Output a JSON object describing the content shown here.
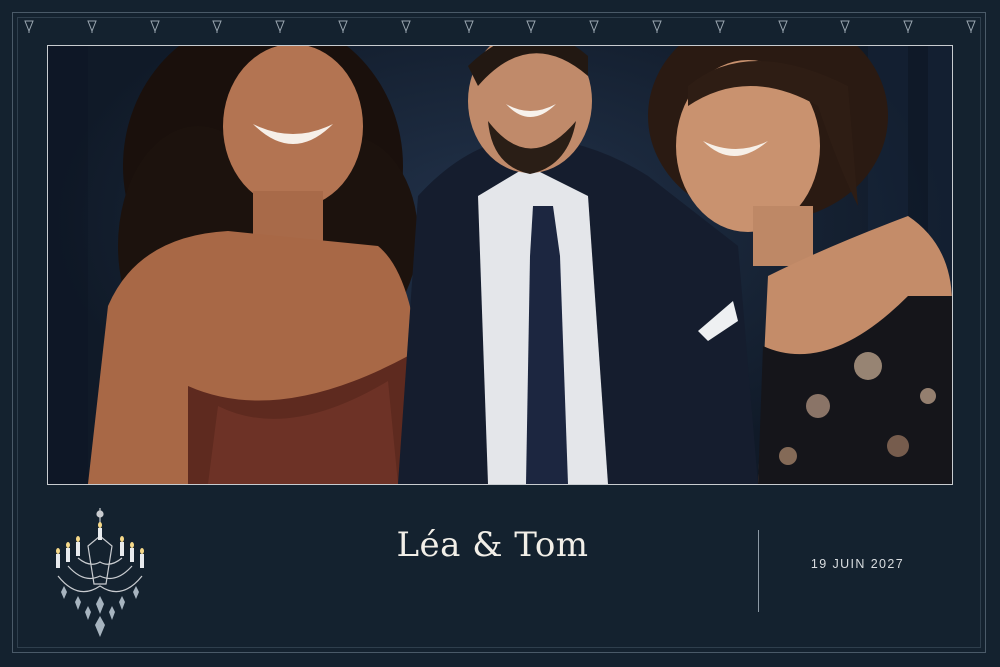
{
  "card": {
    "names": "Léa & Tom",
    "date": "19 JUIN 2027"
  },
  "colors": {
    "background": "#14222f",
    "frame_line": "#4a5a68",
    "text": "#f2efe8"
  },
  "icons": {
    "top_ornament": "fleur-drop-icon",
    "bottom_left": "chandelier-icon"
  },
  "photo": {
    "subject": "three smiling people in evening wear"
  }
}
